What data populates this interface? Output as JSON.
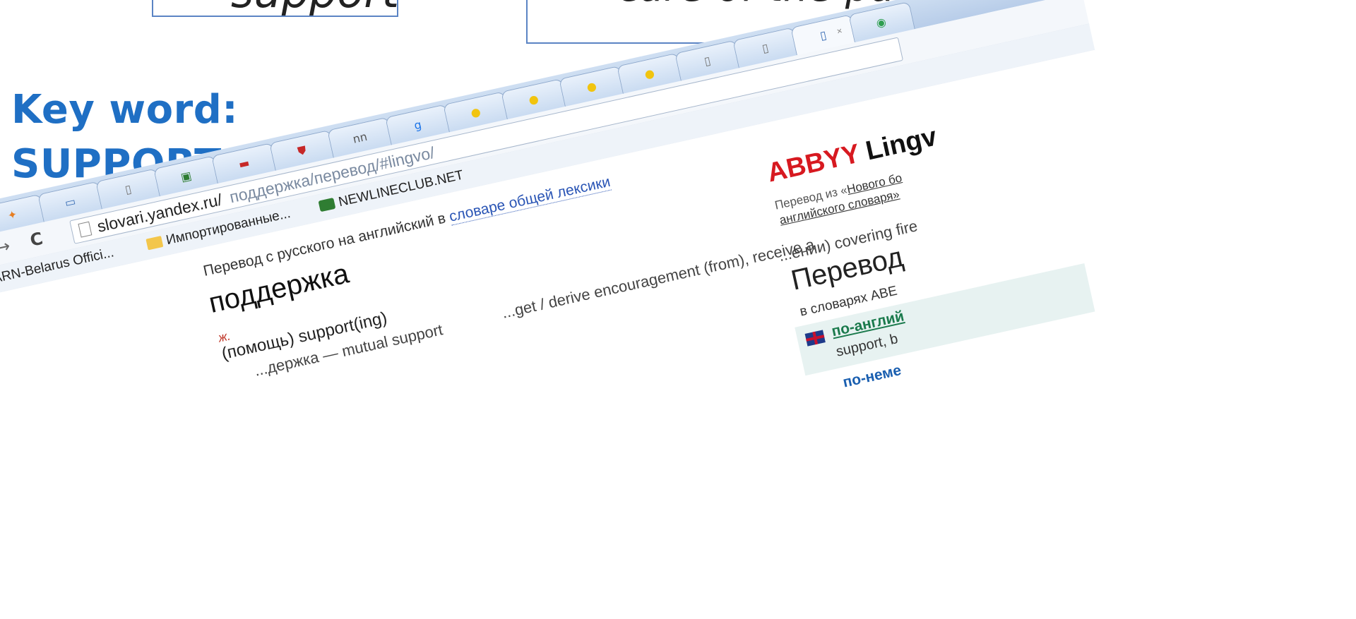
{
  "slide": {
    "box_left_text": "support",
    "box_right_text": "care of the partner",
    "keyword_title": "Key word:",
    "keyword_value": "SUPPORT"
  },
  "browser": {
    "tab_icons": [
      "fire-icon",
      "window-icon",
      "page-icon",
      "chalkboard-icon",
      "pdf-icon",
      "shield-icon",
      "nn-icon",
      "google-icon",
      "bee-icon",
      "bee-icon",
      "bee-icon",
      "bee-icon",
      "page-icon",
      "page-icon",
      "active-page-icon",
      "green-app-icon"
    ],
    "active_tab_close": "×",
    "url_host": "slovari.yandex.ru/",
    "url_path": "поддержка/перевод/#lingvo/",
    "bookmarks": [
      "EARN-Belarus Offici...",
      "Импортированные...",
      "NEWLINECLUB.NET"
    ]
  },
  "content": {
    "translation_prefix": "Перевод с русского на английский в ",
    "translation_link": "словаре общей лексики",
    "headword": "поддержка",
    "gender": "ж.",
    "sense1": "(помощь) support(ing)",
    "sense2": "...держка — mutual support",
    "sense3": "...get / derive encouragement (from), receive a",
    "sense4": "...ении) covering fire"
  },
  "panel": {
    "brand_abbyy": "ABBYY",
    "brand_lingvo": " Lingv",
    "source_prefix": "Перевод из «",
    "source_link": "Нового бо",
    "source_link2": "английского словаря»",
    "heading": "Перевод",
    "in_dictionaries": "в словарях АВЕ",
    "lang_link": "по-англий",
    "lang_sub": "support, b",
    "lang2": "по-неме"
  }
}
